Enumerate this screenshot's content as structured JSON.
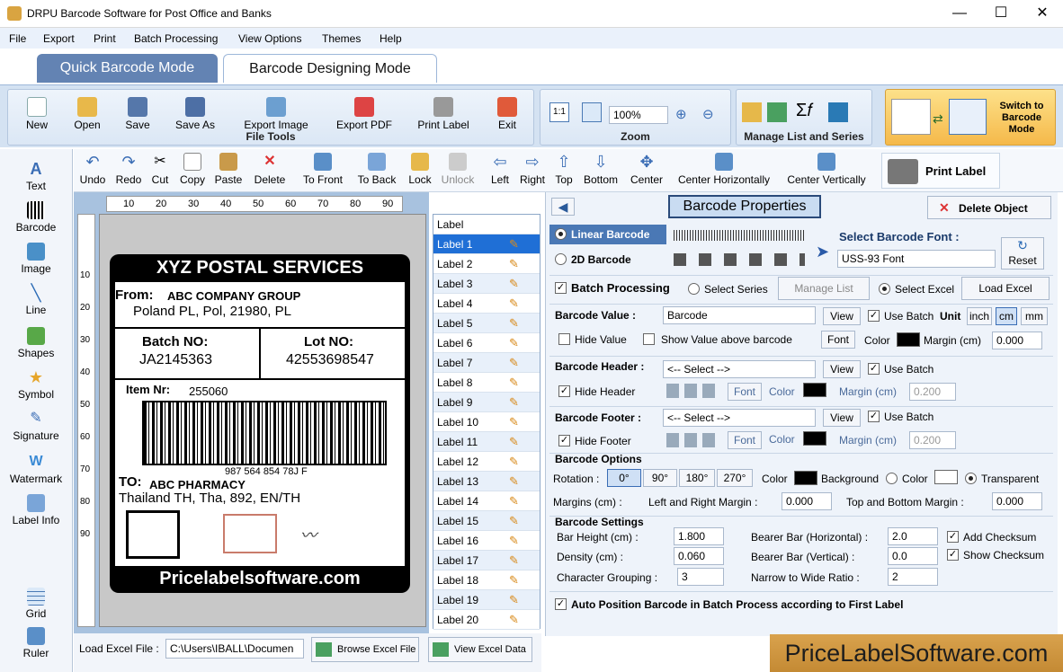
{
  "window": {
    "title": "DRPU Barcode Software for Post Office and Banks",
    "min": "—",
    "max": "☐",
    "close": "✕"
  },
  "menu": [
    "File",
    "Export",
    "Print",
    "Batch Processing",
    "View Options",
    "Themes",
    "Help"
  ],
  "tabs": {
    "quick": "Quick Barcode Mode",
    "design": "Barcode Designing Mode"
  },
  "ribbon": {
    "file_tools": {
      "title": "File Tools",
      "buttons": [
        "New",
        "Open",
        "Save",
        "Save As",
        "Export Image",
        "Export PDF",
        "Print Label",
        "Exit"
      ]
    },
    "zoom": {
      "title": "Zoom",
      "value": "100%"
    },
    "manage": {
      "title": "Manage List and Series"
    },
    "switch": "Switch to Barcode Mode"
  },
  "toolbox": [
    "Text",
    "Barcode",
    "Image",
    "Line",
    "Shapes",
    "Symbol",
    "Signature",
    "Watermark",
    "Label Info",
    "Grid",
    "Ruler"
  ],
  "edit_toolbar": [
    "Undo",
    "Redo",
    "Cut",
    "Copy",
    "Paste",
    "Delete",
    "To Front",
    "To Back",
    "Lock",
    "Unlock",
    "Left",
    "Right",
    "Top",
    "Bottom",
    "Center",
    "Center Horizontally",
    "Center Vertically"
  ],
  "print_label": "Print Label",
  "ruler": {
    "top": [
      "10",
      "20",
      "30",
      "40",
      "50",
      "60",
      "70",
      "80",
      "90"
    ],
    "left": [
      "10",
      "20",
      "30",
      "40",
      "50",
      "60",
      "70",
      "80",
      "90"
    ]
  },
  "label": {
    "header": "XYZ POSTAL SERVICES",
    "from_label": "From:",
    "from_company": "ABC COMPANY GROUP",
    "from_address": "Poland PL, Pol, 21980, PL",
    "batch_label": "Batch NO:",
    "batch_value": "JA2145363",
    "lot_label": "Lot NO:",
    "lot_value": "42553698547",
    "item_label": "Item Nr:",
    "item_value": "255060",
    "barcode_text": "987 564 854 78J F",
    "to_label": "TO:",
    "to_company": "ABC PHARMACY",
    "to_address": "Thailand TH, Tha, 892, EN/TH",
    "footer": "Pricelabelsoftware.com"
  },
  "label_list": {
    "header": "Label",
    "items": [
      "Label 1",
      "Label 2",
      "Label 3",
      "Label 4",
      "Label 5",
      "Label 6",
      "Label 7",
      "Label 8",
      "Label 9",
      "Label 10",
      "Label 11",
      "Label 12",
      "Label 13",
      "Label 14",
      "Label 15",
      "Label 16",
      "Label 17",
      "Label 18",
      "Label 19",
      "Label 20"
    ],
    "selected": 0
  },
  "bottom": {
    "load_excel_label": "Load Excel File :",
    "excel_path": "C:\\Users\\IBALL\\Documen",
    "browse": "Browse Excel File",
    "view": "View Excel Data"
  },
  "props": {
    "title": "Barcode Properties",
    "delete": "Delete Object",
    "linear": "Linear Barcode",
    "twod": "2D Barcode",
    "select_font_label": "Select Barcode Font :",
    "font_value": "USS-93 Font",
    "reset": "Reset",
    "batch_processing": "Batch Processing",
    "select_series": "Select Series",
    "manage_list": "Manage List",
    "select_excel": "Select Excel",
    "load_excel": "Load Excel",
    "barcode_value_label": "Barcode Value :",
    "barcode_value": "Barcode",
    "view": "View",
    "use_batch": "Use Batch",
    "unit": "Unit",
    "units": [
      "inch",
      "cm",
      "mm"
    ],
    "hide_value": "Hide Value",
    "show_above": "Show Value above barcode",
    "font": "Font",
    "color": "Color",
    "margin_cm": "Margin (cm)",
    "margin_value": "0.000",
    "header_label": "Barcode Header :",
    "select_placeholder": "<-- Select -->",
    "hide_header": "Hide Header",
    "header_margin": "0.200",
    "footer_label": "Barcode Footer :",
    "hide_footer": "Hide Footer",
    "footer_margin": "0.200",
    "options_title": "Barcode Options",
    "rotation": "Rotation :",
    "rotations": [
      "0°",
      "90°",
      "180°",
      "270°"
    ],
    "background": "Background",
    "transparent": "Transparent",
    "margins_cm": "Margins (cm) :",
    "lr_margin": "Left and Right Margin :",
    "lr_value": "0.000",
    "tb_margin": "Top and Bottom Margin :",
    "tb_value": "0.000",
    "settings_title": "Barcode Settings",
    "bar_height": "Bar Height (cm) :",
    "bar_height_v": "1.800",
    "density": "Density (cm) :",
    "density_v": "0.060",
    "char_group": "Character Grouping :",
    "char_group_v": "3",
    "bearer_h": "Bearer Bar (Horizontal) :",
    "bearer_h_v": "2.0",
    "bearer_v": "Bearer Bar (Vertical) :",
    "bearer_v_v": "0.0",
    "narrow_wide": "Narrow to Wide Ratio :",
    "narrow_wide_v": "2",
    "add_checksum": "Add Checksum",
    "show_checksum": "Show Checksum",
    "auto_position": "Auto Position Barcode in Batch Process according to First Label"
  },
  "brand": "PriceLabelSoftware.com",
  "colors": {
    "accent": "#3a6db5",
    "tab_active": "#5c7fb0"
  }
}
